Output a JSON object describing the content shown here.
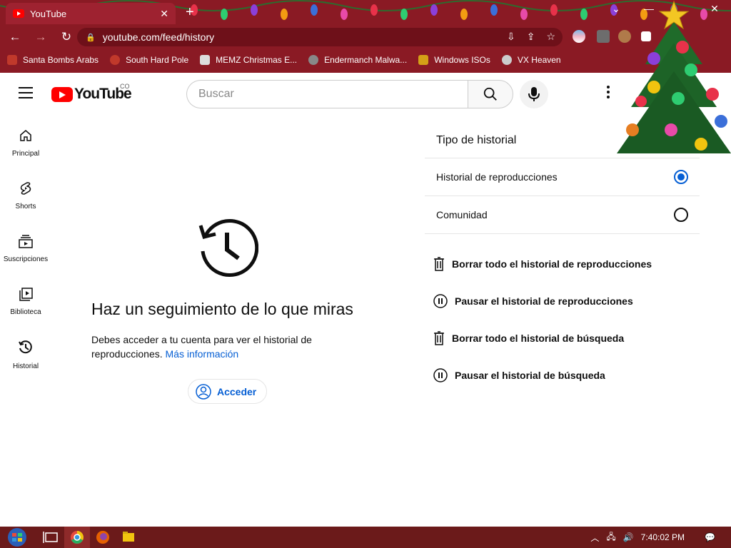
{
  "browser": {
    "tab_title": "YouTube",
    "url": "youtube.com/feed/history",
    "bookmarks": [
      {
        "label": "Santa Bombs Arabs",
        "icon": "santa-icon",
        "color": "#c0392b"
      },
      {
        "label": "South Hard Pole",
        "icon": "snowflake-icon",
        "color": "#c0392b"
      },
      {
        "label": "MEMZ Christmas E...",
        "icon": "memz-icon",
        "color": "#dddddd"
      },
      {
        "label": "Endermanch Malwa...",
        "icon": "endermanch-icon",
        "color": "#888888"
      },
      {
        "label": "Windows ISOs",
        "icon": "windows-icon",
        "color": "#d4a017"
      },
      {
        "label": "VX Heaven",
        "icon": "vx-icon",
        "color": "#cccccc"
      }
    ]
  },
  "youtube": {
    "country_code": "CO",
    "search_placeholder": "Buscar",
    "guide": [
      {
        "label": "Principal",
        "icon": "home-icon"
      },
      {
        "label": "Shorts",
        "icon": "shorts-icon"
      },
      {
        "label": "Suscripciones",
        "icon": "subscriptions-icon"
      },
      {
        "label": "Biblioteca",
        "icon": "library-icon"
      },
      {
        "label": "Historial",
        "icon": "history-icon"
      }
    ],
    "empty_state": {
      "title": "Haz un seguimiento de lo que miras",
      "description": "Debes acceder a tu cuenta para ver el historial de reproducciones.",
      "link": "Más información",
      "signin_label": "Acceder"
    },
    "panel": {
      "title": "Tipo de historial",
      "options": [
        {
          "label": "Historial de reproducciones",
          "selected": true
        },
        {
          "label": "Comunidad",
          "selected": false
        }
      ],
      "actions": [
        {
          "label": "Borrar todo el historial de reproducciones",
          "icon": "trash-icon"
        },
        {
          "label": "Pausar el historial de reproducciones",
          "icon": "pause-icon"
        },
        {
          "label": "Borrar todo el historial de búsqueda",
          "icon": "trash-icon"
        },
        {
          "label": "Pausar el historial de búsqueda",
          "icon": "pause-icon"
        }
      ]
    }
  },
  "taskbar": {
    "clock": "7:40:02 PM"
  }
}
